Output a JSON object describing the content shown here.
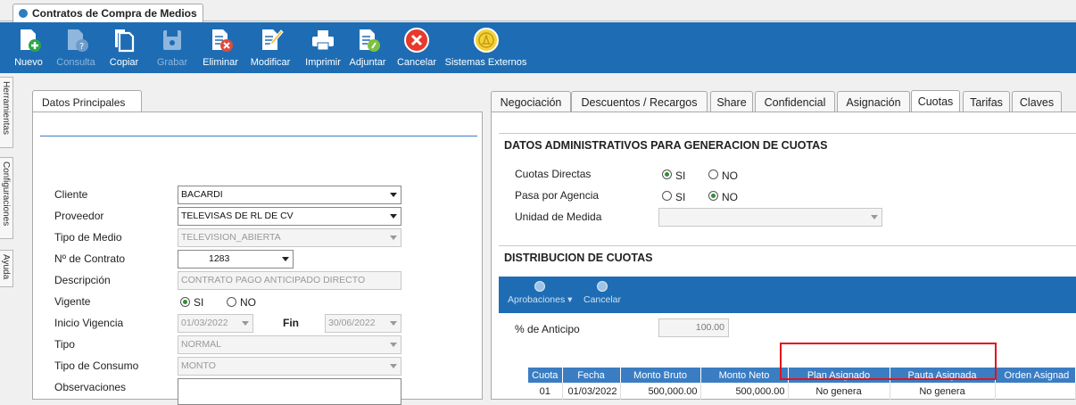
{
  "window": {
    "tab_title": "Contratos de Compra de Medios"
  },
  "toolbar": {
    "buttons": [
      {
        "label": "Nuevo",
        "icon": "new-document-icon",
        "enabled": true
      },
      {
        "label": "Consulta",
        "icon": "query-document-icon",
        "enabled": false
      },
      {
        "label": "Copiar",
        "icon": "copy-icon",
        "enabled": true
      },
      {
        "label": "Grabar",
        "icon": "save-disk-icon",
        "enabled": false
      },
      {
        "label": "Eliminar",
        "icon": "delete-document-icon",
        "enabled": true
      },
      {
        "label": "Modificar",
        "icon": "edit-pencil-icon",
        "enabled": true
      },
      {
        "label": "Imprimir",
        "icon": "printer-icon",
        "enabled": true
      },
      {
        "label": "Adjuntar",
        "icon": "attach-document-icon",
        "enabled": true
      },
      {
        "label": "Cancelar",
        "icon": "cancel-circle-icon",
        "enabled": true
      },
      {
        "label": "Sistemas Externos",
        "icon": "external-systems-icon",
        "enabled": true
      }
    ]
  },
  "sidebar": {
    "tabs": [
      "Herramientas",
      "Configuraciones",
      "Ayuda"
    ]
  },
  "left_panel": {
    "tab": "Datos Principales",
    "fields": {
      "cliente": {
        "label": "Cliente",
        "value": "BACARDI"
      },
      "proveedor": {
        "label": "Proveedor",
        "value": "TELEVISAS DE RL DE CV"
      },
      "tipo_medio": {
        "label": "Tipo de Medio",
        "value": "TELEVISION_ABIERTA"
      },
      "num_contrato": {
        "label": "Nº de Contrato",
        "value": "1283"
      },
      "descripcion": {
        "label": "Descripción",
        "value": "CONTRATO PAGO ANTICIPADO DIRECTO"
      },
      "vigente": {
        "label": "Vigente",
        "opt_si": "SI",
        "opt_no": "NO",
        "selected": "SI"
      },
      "inicio_vigencia": {
        "label": "Inicio Vigencia",
        "value": "01/03/2022"
      },
      "fin": {
        "label": "Fin",
        "value": "30/06/2022"
      },
      "tipo": {
        "label": "Tipo",
        "value": "NORMAL"
      },
      "tipo_consumo": {
        "label": "Tipo de Consumo",
        "value": "MONTO"
      },
      "observaciones": {
        "label": "Observaciones",
        "value": ""
      }
    }
  },
  "right_panel": {
    "tabs": [
      "Negociación",
      "Descuentos / Recargos",
      "Share",
      "Confidencial",
      "Asignación",
      "Cuotas",
      "Tarifas",
      "Claves"
    ],
    "active_tab": "Cuotas",
    "section1_title": "DATOS ADMINISTRATIVOS PARA GENERACION DE CUOTAS",
    "cuotas_directas": {
      "label": "Cuotas Directas",
      "opt_si": "SI",
      "opt_no": "NO",
      "selected": "SI"
    },
    "pasa_por_agencia": {
      "label": "Pasa por Agencia",
      "opt_si": "SI",
      "opt_no": "NO",
      "selected": "NO"
    },
    "unidad_medida": {
      "label": "Unidad de Medida",
      "value": ""
    },
    "section2_title": "DISTRIBUCION DE CUOTAS",
    "subtoolbar": {
      "aprobaciones": "Aprobaciones",
      "cancelar": "Cancelar"
    },
    "anticipo": {
      "label": "% de Anticipo",
      "value": "100.00"
    },
    "grid": {
      "columns": [
        "Cuota",
        "Fecha",
        "Monto Bruto",
        "Monto Neto",
        "Plan Asignado",
        "Pauta Asignada",
        "Orden Asignad"
      ],
      "rows": [
        [
          "01",
          "01/03/2022",
          "500,000.00",
          "500,000.00",
          "No genera",
          "No genera",
          ""
        ]
      ]
    }
  }
}
